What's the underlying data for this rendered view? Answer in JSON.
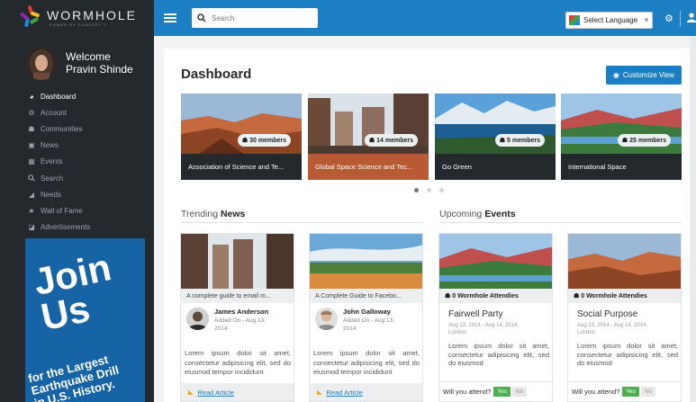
{
  "app": {
    "logo_text": "WORMHOLE",
    "logo_subtext": "POWER BY CONCEPT 7"
  },
  "profile": {
    "welcome": "Welcome",
    "name": "Pravin Shinde"
  },
  "sidebar": {
    "items": [
      {
        "label": "Dashboard",
        "icon": "dashboard-icon",
        "active": true
      },
      {
        "label": "Account",
        "icon": "cogs-icon",
        "active": false
      },
      {
        "label": "Communities",
        "icon": "users-icon",
        "active": false
      },
      {
        "label": "News",
        "icon": "newspaper-icon",
        "active": false
      },
      {
        "label": "Events",
        "icon": "calendar-icon",
        "active": false
      },
      {
        "label": "Search",
        "icon": "search-icon",
        "active": false
      },
      {
        "label": "Needs",
        "icon": "megaphone-icon",
        "active": false
      },
      {
        "label": "Wall of Fame",
        "icon": "star-icon",
        "active": false
      },
      {
        "label": "Advertisements",
        "icon": "ad-icon",
        "active": false
      }
    ],
    "ad": {
      "headline": "Join Us",
      "line1": "for the Largest",
      "line2": "Earthquake Drill",
      "line3": "in U.S. History."
    }
  },
  "topbar": {
    "search_placeholder": "Search",
    "language_label": "Select Language",
    "language_caret": "▼"
  },
  "main": {
    "title": "Dashboard",
    "customize_label": "Customize View",
    "communities": [
      {
        "name": "Association of Science and Te...",
        "members": "30 members"
      },
      {
        "name": "Global Space Science and Tec...",
        "members": "14 members"
      },
      {
        "name": "Go Green",
        "members": "5 members"
      },
      {
        "name": "International Space",
        "members": "25 members"
      }
    ],
    "trending": {
      "title_prefix": "Trending ",
      "title_bold": "News"
    },
    "upcoming": {
      "title_prefix": "Upcoming ",
      "title_bold": "Events"
    },
    "news": [
      {
        "title": "A complete guide to email m...",
        "author": "James Anderson",
        "date_line1": "Added On - Aug 13,",
        "date_line2": "2014",
        "text": "Lorem ipsum dolor sit amet, consectetur adipisicing elit, sed do eiusmod tempor incididunt",
        "read_label": "Read Article"
      },
      {
        "title": "A Complete Guide to Facebo...",
        "author": "John Galloway",
        "date_line1": "Added On - Aug 13,",
        "date_line2": "2014",
        "text": "Lorem ipsum dolor sit amet, consectetur adipisicing elit, sed do eiusmod tempor incididunt",
        "read_label": "Read Article"
      }
    ],
    "events": [
      {
        "attendees": "0 Wormhole Attendies",
        "title": "Fairwell Party",
        "date": "Aug 13, 2014 - Aug 14, 2014,",
        "location": "London",
        "text": "Lorem ipsum dolor sit amet, consectetur adipisicing elit, sed do eiusmod",
        "question": "Will you attend?",
        "yes": "Yes",
        "no": "No"
      },
      {
        "attendees": "0 Wormhole Attendies",
        "title": "Social Purpose",
        "date": "Aug 13, 2014 - Aug 14, 2014,",
        "location": "London",
        "text": "Lorem ipsum dolor sit amet, consectetur adipisicing elit, sed do eiusmod",
        "question": "Will you attend?",
        "yes": "Yes",
        "no": "No"
      }
    ]
  },
  "colors": {
    "sidebar": "#24292d",
    "topbar": "#1d7fc3",
    "accent": "#1d7fc3",
    "highlight_caption": "#b85a34",
    "yes_button": "#4caf50"
  }
}
